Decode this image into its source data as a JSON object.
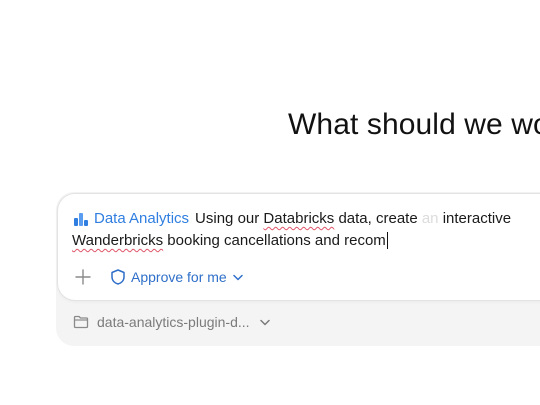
{
  "headline": "What should we wo",
  "composer": {
    "plugin_label": "Data Analytics",
    "line1_a": "Using our ",
    "line1_databricks": "Databricks",
    "line1_b": " data, create",
    "line1_fade": " an ",
    "line1_c": "interactive",
    "line2_wanderbricks": "Wanderbricks",
    "line2_rest": " booking cancellations and recom",
    "plus_icon": "plus-icon",
    "approve_label": "Approve for me"
  },
  "folder": {
    "label": "data-analytics-plugin-d...",
    "icon": "folder-icon"
  },
  "colors": {
    "accent": "#2f7ee0",
    "approve": "#2f6fc9",
    "muted": "#7b7b7b"
  }
}
